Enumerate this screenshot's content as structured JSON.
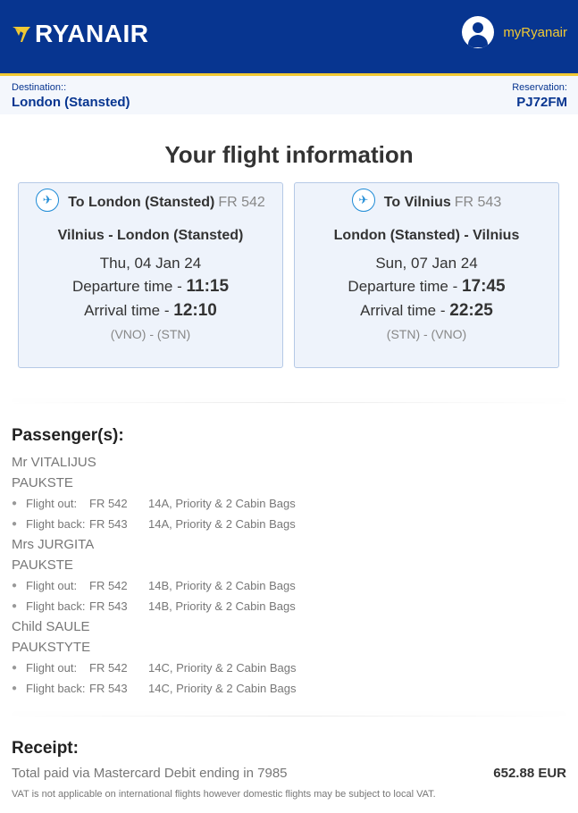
{
  "header": {
    "brand": "RYANAIR",
    "account_label": "myRyanair",
    "icons": {
      "logo": "harp-logo-icon",
      "avatar": "user-avatar-icon"
    },
    "colors": {
      "brand_blue": "#073590",
      "brand_yellow": "#f1c933"
    }
  },
  "booking": {
    "destination_label": "Destination::",
    "destination": "London (Stansted)",
    "reservation_label": "Reservation:",
    "reservation": "PJ72FM"
  },
  "page_title": "Your flight information",
  "flights": [
    {
      "to": "To London (Stansted)",
      "flight_no": "FR 542",
      "route": "Vilnius - London (Stansted)",
      "date": "Thu, 04 Jan 24",
      "departure_label": "Departure time - ",
      "departure_time": "11:15",
      "arrival_label": "Arrival time - ",
      "arrival_time": "12:10",
      "codes": "(VNO) - (STN)",
      "icon": "plane-takeoff-icon"
    },
    {
      "to": "To Vilnius",
      "flight_no": "FR 543",
      "route": "London (Stansted) - Vilnius",
      "date": "Sun, 07 Jan 24",
      "departure_label": "Departure time - ",
      "departure_time": "17:45",
      "arrival_label": "Arrival time - ",
      "arrival_time": "22:25",
      "codes": "(STN) - (VNO)",
      "icon": "plane-takeoff-icon"
    }
  ],
  "passengers": {
    "title": "Passenger(s):",
    "list": [
      {
        "name": "Mr VITALIJUS PAUKSTE",
        "legs": [
          {
            "label": "Flight out:",
            "flight": "FR 542",
            "detail": "14A, Priority & 2 Cabin Bags"
          },
          {
            "label": "Flight back:",
            "flight": "FR 543",
            "detail": "14A, Priority & 2 Cabin Bags"
          }
        ]
      },
      {
        "name": "Mrs JURGITA PAUKSTE",
        "legs": [
          {
            "label": "Flight out:",
            "flight": "FR 542",
            "detail": "14B, Priority & 2 Cabin Bags"
          },
          {
            "label": "Flight back:",
            "flight": "FR 543",
            "detail": "14B, Priority & 2 Cabin Bags"
          }
        ]
      },
      {
        "name": "Child SAULE PAUKSTYTE",
        "legs": [
          {
            "label": "Flight out:",
            "flight": "FR 542",
            "detail": "14C, Priority & 2 Cabin Bags"
          },
          {
            "label": "Flight back:",
            "flight": "FR 543",
            "detail": "14C, Priority & 2 Cabin Bags"
          }
        ]
      }
    ]
  },
  "receipt": {
    "title": "Receipt:",
    "payment_text": "Total paid via Mastercard Debit ending in 7985",
    "amount": "652.88 EUR",
    "vat_note": "VAT is not applicable on international flights however domestic flights may be subject to local VAT."
  }
}
